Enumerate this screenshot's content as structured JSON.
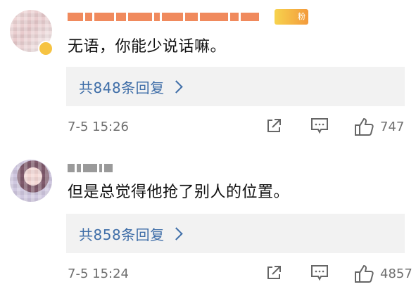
{
  "comments": [
    {
      "text": "无语，你能少说话嘛。",
      "fan_badge": "粉",
      "reply_label": "共848条回复",
      "time": "7-5 15:26",
      "likes": "747"
    },
    {
      "text": "但是总觉得他抢了别人的位置。",
      "reply_label": "共858条回复",
      "time": "7-5 15:24",
      "likes": "4857"
    }
  ],
  "icons": {
    "share": "share-icon",
    "reply": "comment-icon",
    "like": "thumbs-up-icon",
    "arrow": "chevron-right-icon"
  },
  "colors": {
    "link": "#3f6ea8",
    "meta": "#707070",
    "reply_bg": "#f2f2f2"
  }
}
